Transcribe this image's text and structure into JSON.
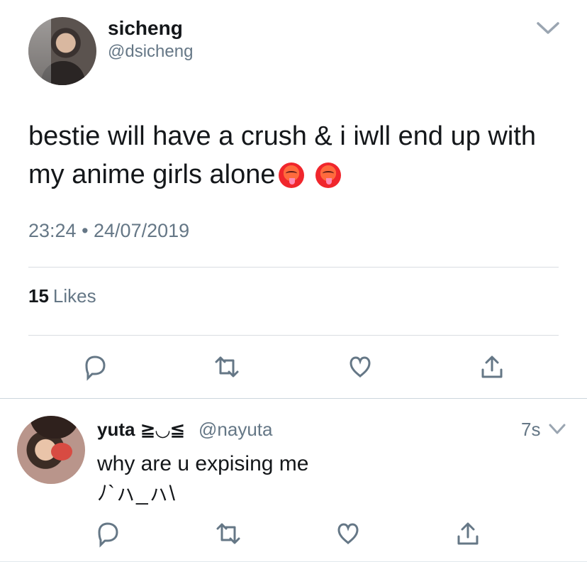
{
  "tweet": {
    "author": {
      "display_name": "sicheng",
      "handle": "@dsicheng",
      "avatar_icon": "profile-photo"
    },
    "text": "bestie will have a crush & i iwll end up with my anime girls alone",
    "emoji": "hot-face-emoji",
    "timestamp": "23:24 • 24/07/2019",
    "likes": {
      "count": "15",
      "label": "Likes"
    },
    "actions": [
      "reply-icon",
      "retweet-icon",
      "like-icon",
      "share-icon"
    ]
  },
  "reply": {
    "author": {
      "display_name": "yuta ≧◡≦",
      "handle": "@nayuta",
      "avatar_icon": "profile-photo"
    },
    "time": "7s",
    "text": "why are u expising me",
    "kaomoji": "ﾉ`ㇵ_ㇵ\\",
    "actions": [
      "reply-icon",
      "retweet-icon",
      "like-icon",
      "share-icon"
    ]
  },
  "colors": {
    "text": "#14171a",
    "muted": "#657786",
    "divider": "#d9dde1"
  }
}
